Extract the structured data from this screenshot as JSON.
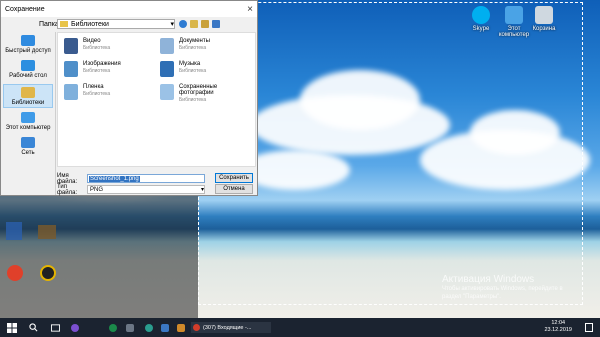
{
  "dialog": {
    "title": "Сохранение",
    "close_icon": "×",
    "path_label": "Папка:",
    "path_value": "Библиотеки",
    "places": [
      {
        "label": "Быстрый доступ",
        "icon": "star-icon",
        "color": "#2f8be0"
      },
      {
        "label": "Рабочий стол",
        "icon": "desktop-icon",
        "color": "#2d8fe0"
      },
      {
        "label": "Библиотеки",
        "icon": "libraries-icon",
        "color": "#e0b64a"
      },
      {
        "label": "Этот компьютер",
        "icon": "computer-icon",
        "color": "#3f9be8"
      },
      {
        "label": "Сеть",
        "icon": "network-icon",
        "color": "#3a86d6"
      }
    ],
    "libraries": [
      {
        "name": "Видео",
        "sub": "Библиотека",
        "icon": "video-library-icon",
        "color": "#3a5b8f"
      },
      {
        "name": "Документы",
        "sub": "Библиотека",
        "icon": "documents-library-icon",
        "color": "#8fb3d9"
      },
      {
        "name": "Изображения",
        "sub": "Библиотека",
        "icon": "pictures-library-icon",
        "color": "#4f8fc9"
      },
      {
        "name": "Музыка",
        "sub": "Библиотека",
        "icon": "music-library-icon",
        "color": "#2f6fb5"
      },
      {
        "name": "Пленка",
        "sub": "Библиотека",
        "icon": "camera-roll-library-icon",
        "color": "#7fb0dc"
      },
      {
        "name": "Сохраненные фотографии",
        "sub": "Библиотека",
        "icon": "saved-pictures-library-icon",
        "color": "#9bc2e6"
      }
    ],
    "filename_label": "Имя файла:",
    "filename_value": "Screenshot_1.png",
    "filetype_label": "Тип файла:",
    "filetype_value": "PNG",
    "save_label": "Сохранить",
    "cancel_label": "Отмена"
  },
  "desktop": {
    "icons": [
      {
        "label": "Skype",
        "icon": "skype-icon",
        "color": "#00aff0"
      },
      {
        "label": "Этот компьютер",
        "icon": "computer-icon",
        "color": "#4aa3e6"
      },
      {
        "label": "Корзина",
        "icon": "recycle-bin-icon",
        "color": "#cfd8e0"
      }
    ],
    "activation_title": "Активация Windows",
    "activation_text": "Чтобы активировать Windows, перейдите в раздел \"Параметры\"."
  },
  "taskbar": {
    "start_icon": "windows-start-icon",
    "task_label": "(307) Входящие -...",
    "clock_time": "12:04",
    "clock_date": "23.12.2019"
  }
}
